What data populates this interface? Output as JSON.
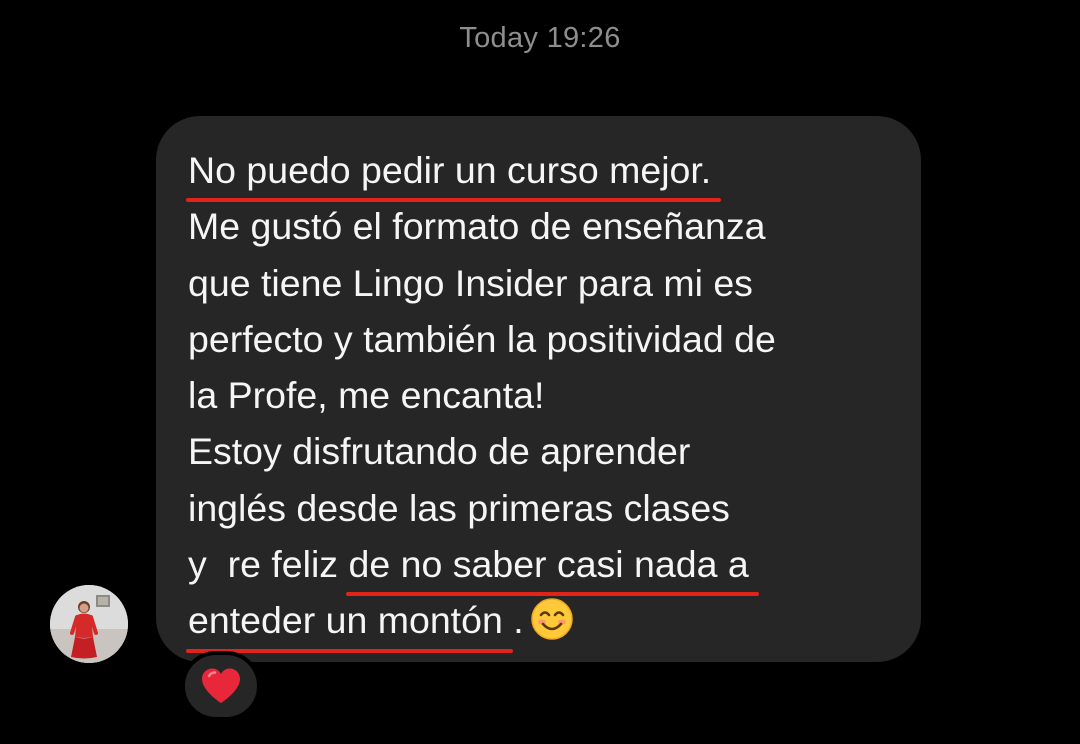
{
  "header": {
    "timestamp": "Today 19:26"
  },
  "message": {
    "lines": [
      {
        "segments": [
          "No puedo pedir un curso mejor."
        ]
      },
      {
        "segments": [
          "Me gustó el formato de enseñanza"
        ]
      },
      {
        "segments": [
          "que tiene Lingo Insider para mi es"
        ]
      },
      {
        "segments": [
          "perfecto y también la positividad de"
        ]
      },
      {
        "segments": [
          "la Profe, me encanta!"
        ]
      },
      {
        "segments": [
          "Estoy disfrutando de aprender"
        ]
      },
      {
        "segments": [
          "inglés desde las primeras clases"
        ]
      },
      {
        "segments": [
          "y  re feliz ",
          "de no saber casi nada a"
        ]
      },
      {
        "segments": [
          "enteder un montón",
          " ."
        ]
      }
    ],
    "emoji": "smiling-face-with-smiling-eyes",
    "underline_color": "#e0241a"
  },
  "reaction": {
    "icon": "red-heart",
    "color": "#e8283a"
  },
  "avatar": {
    "icon": "profile-photo"
  },
  "colors": {
    "background": "#000000",
    "bubble": "#262626",
    "text": "#f5f5f5",
    "timestamp": "#8e8e8e"
  }
}
